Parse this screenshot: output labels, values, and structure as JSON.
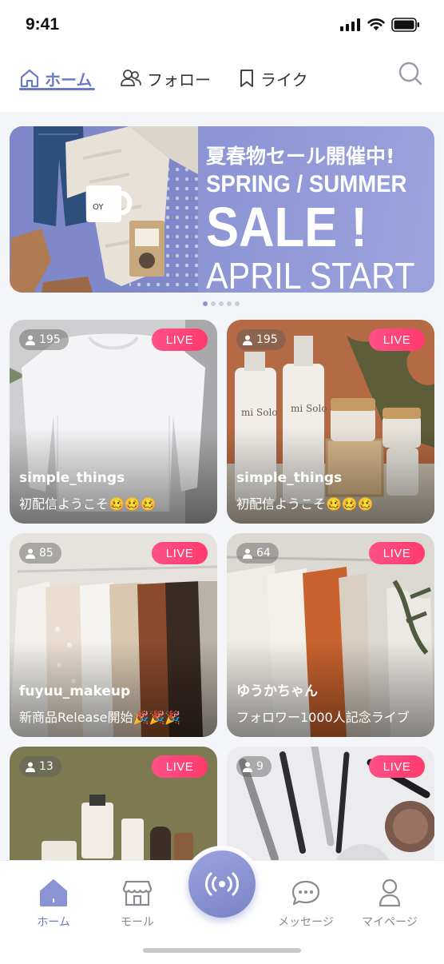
{
  "status_bar": {
    "time": "9:41"
  },
  "top_nav": {
    "tabs": [
      {
        "label": "ホーム",
        "active": true
      },
      {
        "label": "フォロー",
        "active": false
      },
      {
        "label": "ライク",
        "active": false
      }
    ]
  },
  "banner": {
    "line1": "夏春物セール開催中!",
    "line2": "SPRING / SUMMER",
    "line3": "SALE !",
    "line4": "APRIL START",
    "page_count": 5,
    "active_page": 1
  },
  "cards": [
    {
      "viewers": "195",
      "badge": "LIVE",
      "user": "simple_things",
      "title": "初配信ようこそ🥴🥴🥴"
    },
    {
      "viewers": "195",
      "badge": "LIVE",
      "user": "simple_things",
      "title": "初配信ようこそ🥴🥴🥴"
    },
    {
      "viewers": "85",
      "badge": "LIVE",
      "user": "fuyuu_makeup",
      "title": "新商品Release開始🎉🎉🎉"
    },
    {
      "viewers": "64",
      "badge": "LIVE",
      "user": "ゆうかちゃん",
      "title": "フォロワー1000人記念ライブ"
    },
    {
      "viewers": "13",
      "badge": "LIVE",
      "user": "",
      "title": ""
    },
    {
      "viewers": "9",
      "badge": "LIVE",
      "user": "",
      "title": ""
    }
  ],
  "bottom_nav": {
    "home": "ホーム",
    "mall": "モール",
    "messages": "メッセージ",
    "mypage": "マイページ"
  },
  "colors": {
    "accent": "#6b7bc4",
    "live": "#ff3b6b"
  }
}
